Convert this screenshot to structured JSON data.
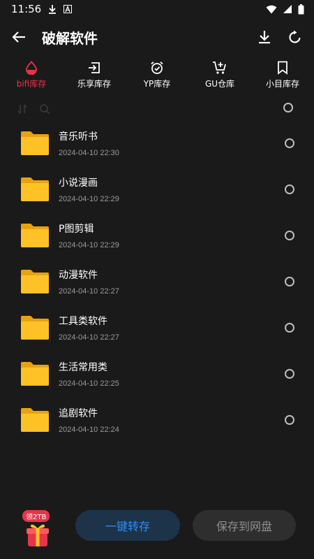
{
  "status_bar": {
    "time": "11:56",
    "icons": [
      "download-icon",
      "a-icon",
      "wifi-icon",
      "signal-icon",
      "battery-icon"
    ]
  },
  "app_bar": {
    "title": "破解软件",
    "back_icon": "arrow-left-icon",
    "actions": [
      "download-icon",
      "refresh-icon"
    ]
  },
  "tabs": [
    {
      "label": "bifi库存",
      "icon": "drop-icon",
      "active": true
    },
    {
      "label": "乐享库存",
      "icon": "login-box-icon",
      "active": false
    },
    {
      "label": "YP库存",
      "icon": "alarm-clock-icon",
      "active": false
    },
    {
      "label": "GU仓库",
      "icon": "cart-plus-icon",
      "active": false
    },
    {
      "label": "小目库存",
      "icon": "bookmark-icon",
      "active": false
    }
  ],
  "toolbar": {
    "icons": [
      "sort-icon",
      "search-icon"
    ]
  },
  "items": [
    {
      "name": "音乐听书",
      "date": "2024-04-10 22:30"
    },
    {
      "name": "小说漫画",
      "date": "2024-04-10 22:29"
    },
    {
      "name": "P图剪辑",
      "date": "2024-04-10 22:29"
    },
    {
      "name": "动漫软件",
      "date": "2024-04-10 22:27"
    },
    {
      "name": "工具类软件",
      "date": "2024-04-10 22:27"
    },
    {
      "name": "生活常用类",
      "date": "2024-04-10 22:25"
    },
    {
      "name": "追剧软件",
      "date": "2024-04-10 22:24"
    }
  ],
  "bottom": {
    "gift_badge": "领2TB",
    "primary_label": "一键转存",
    "secondary_label": "保存到网盘"
  },
  "colors": {
    "accent_red": "#e8344a",
    "primary_blue": "#2f8ef0",
    "folder_yellow": "#ffc226",
    "background": "#1a1a1a"
  }
}
